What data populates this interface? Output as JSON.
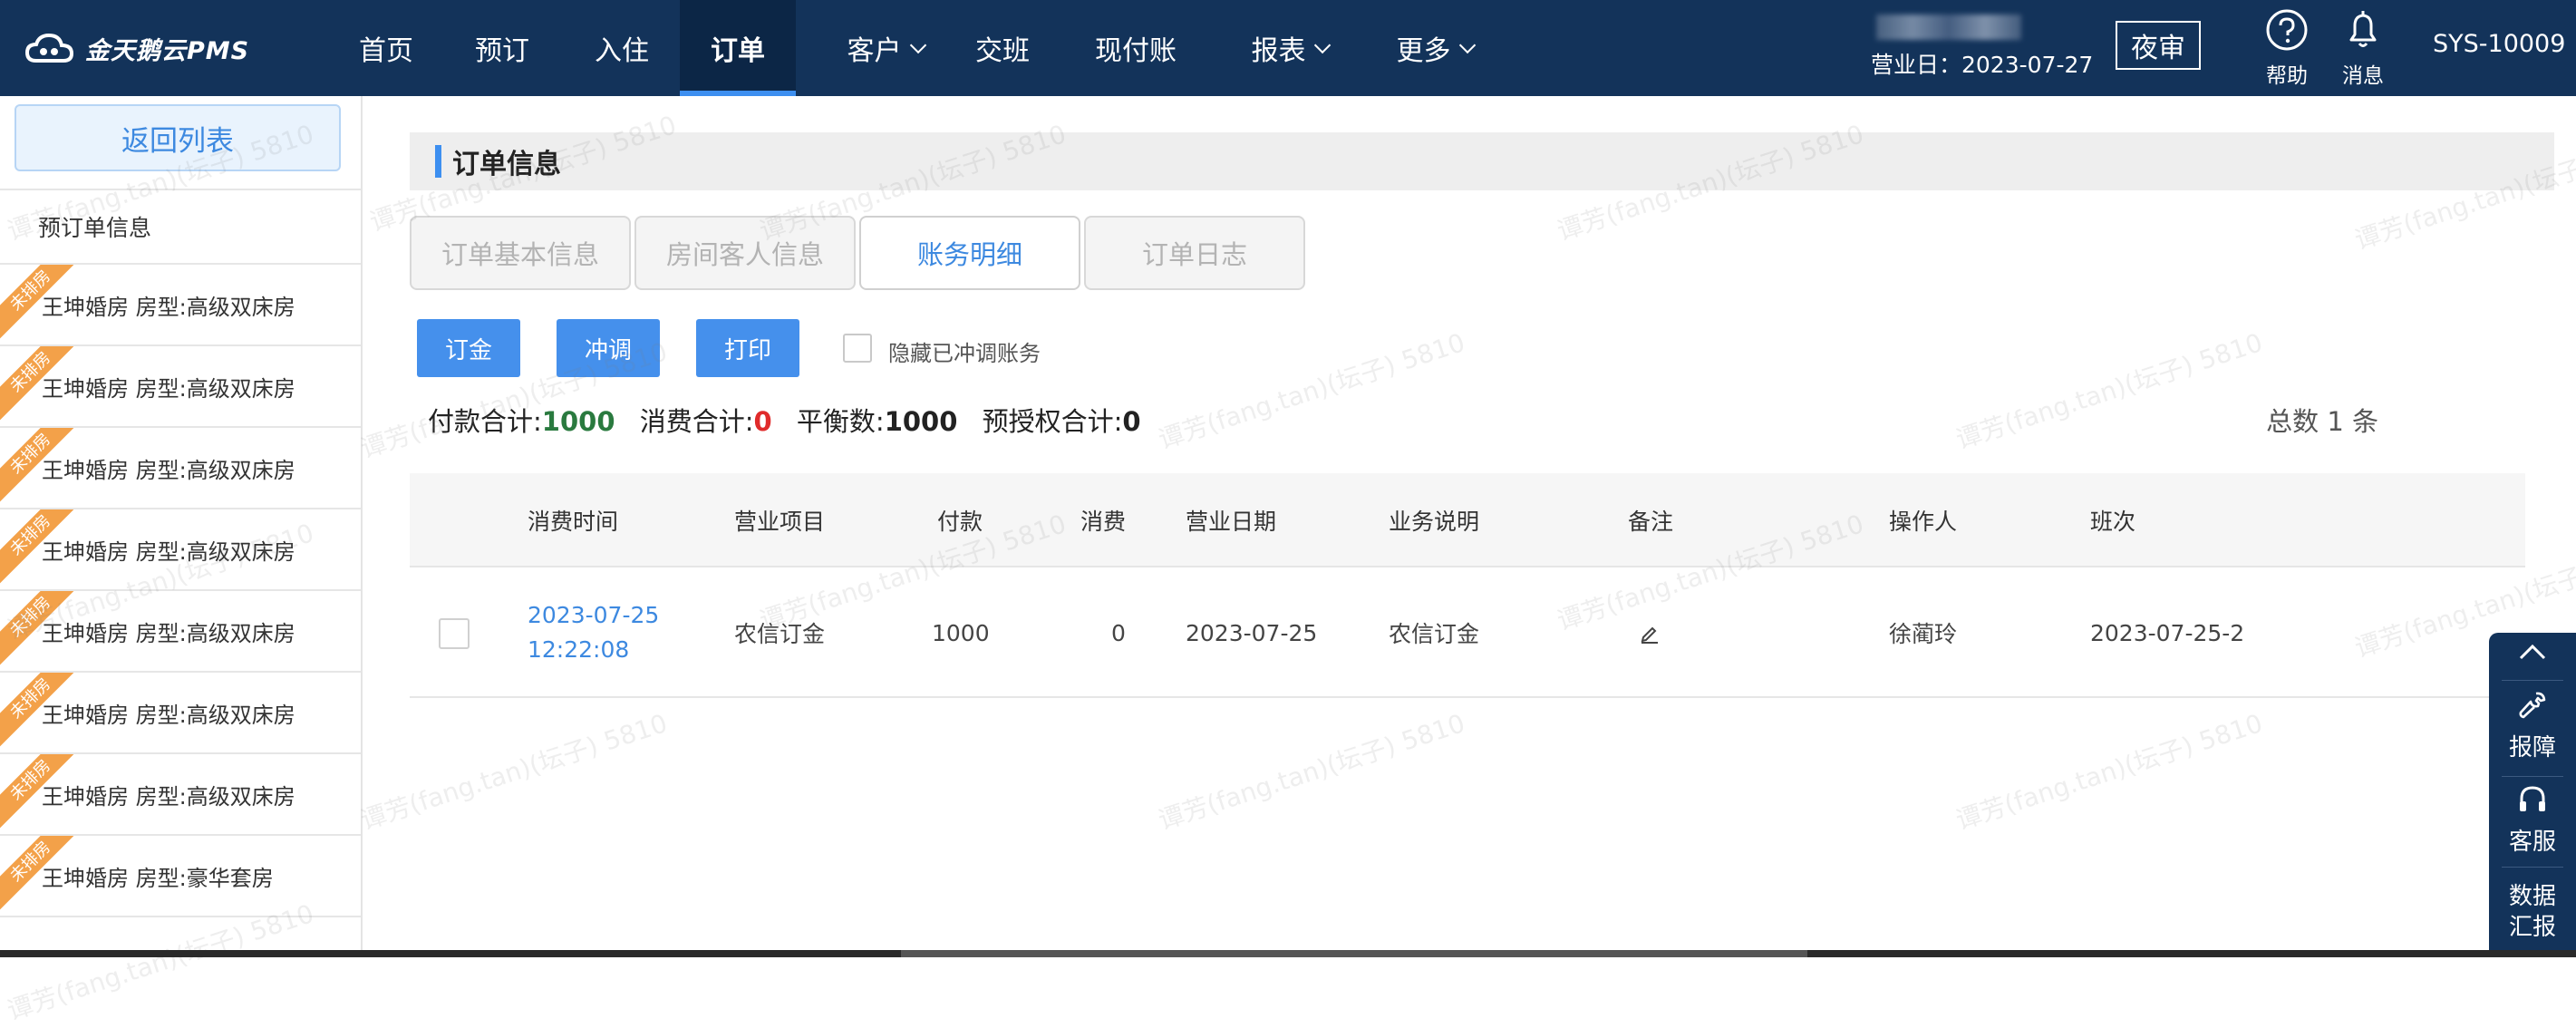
{
  "app": {
    "logo_text": "金天鹅云PMS"
  },
  "topnav": {
    "items": [
      {
        "label": "首页",
        "has_dropdown": false
      },
      {
        "label": "预订",
        "has_dropdown": false
      },
      {
        "label": "入住",
        "has_dropdown": false
      },
      {
        "label": "订单",
        "has_dropdown": false,
        "active": true
      },
      {
        "label": "客户",
        "has_dropdown": true
      },
      {
        "label": "交班",
        "has_dropdown": false
      },
      {
        "label": "现付账",
        "has_dropdown": false
      },
      {
        "label": "报表",
        "has_dropdown": true
      },
      {
        "label": "更多",
        "has_dropdown": true
      }
    ],
    "business_date": "营业日：2023-07-27",
    "night_audit": "夜审",
    "help": "帮助",
    "messages": "消息",
    "user": "SYS-10009"
  },
  "sidebar": {
    "back_button": "返回列表",
    "header": "预订单信息",
    "ribbon_text": "未排房",
    "rooms": [
      {
        "label": "王坤婚房  房型:高级双床房"
      },
      {
        "label": "王坤婚房  房型:高级双床房"
      },
      {
        "label": "王坤婚房  房型:高级双床房"
      },
      {
        "label": "王坤婚房  房型:高级双床房"
      },
      {
        "label": "王坤婚房  房型:高级双床房"
      },
      {
        "label": "王坤婚房  房型:高级双床房"
      },
      {
        "label": "王坤婚房  房型:高级双床房"
      },
      {
        "label": "王坤婚房  房型:豪华套房"
      }
    ]
  },
  "main": {
    "section_title": "订单信息",
    "tabs": [
      {
        "label": "订单基本信息",
        "active": false
      },
      {
        "label": "房间客人信息",
        "active": false
      },
      {
        "label": "账务明细",
        "active": true
      },
      {
        "label": "订单日志",
        "active": false
      }
    ],
    "actions": {
      "deposit": "订金",
      "adjust": "冲调",
      "print": "打印"
    },
    "hide_adjusted_label": "隐藏已冲调账务",
    "summary": {
      "payment_label": "付款合计:",
      "payment_value": "1000",
      "consumption_label": "消费合计:",
      "consumption_value": "0",
      "balance_label": "平衡数:",
      "balance_value": "1000",
      "preauth_label": "预授权合计:",
      "preauth_value": "0"
    },
    "total_count": "总数 1 条",
    "table": {
      "headers": [
        "消费时间",
        "营业项目",
        "付款",
        "消费",
        "营业日期",
        "业务说明",
        "备注",
        "操作人",
        "班次"
      ],
      "rows": [
        {
          "time_date": "2023-07-25",
          "time_clock": "12:22:08",
          "item": "农信订金",
          "payment": "1000",
          "consumption": "0",
          "business_date": "2023-07-25",
          "description": "农信订金",
          "operator": "徐蔺玲",
          "shift": "2023-07-25-2"
        }
      ]
    }
  },
  "float_panel": {
    "report": "报障",
    "service": "客服",
    "data_report_1": "数据",
    "data_report_2": "汇报"
  },
  "watermark_text": "谭芳(fang.tan)(坛子) 5810",
  "colors": {
    "nav_bg": "#13335a",
    "accent": "#3d8ff0",
    "ribbon": "#f3a149",
    "positive": "#2a7a3f",
    "negative": "#e02b2b"
  }
}
